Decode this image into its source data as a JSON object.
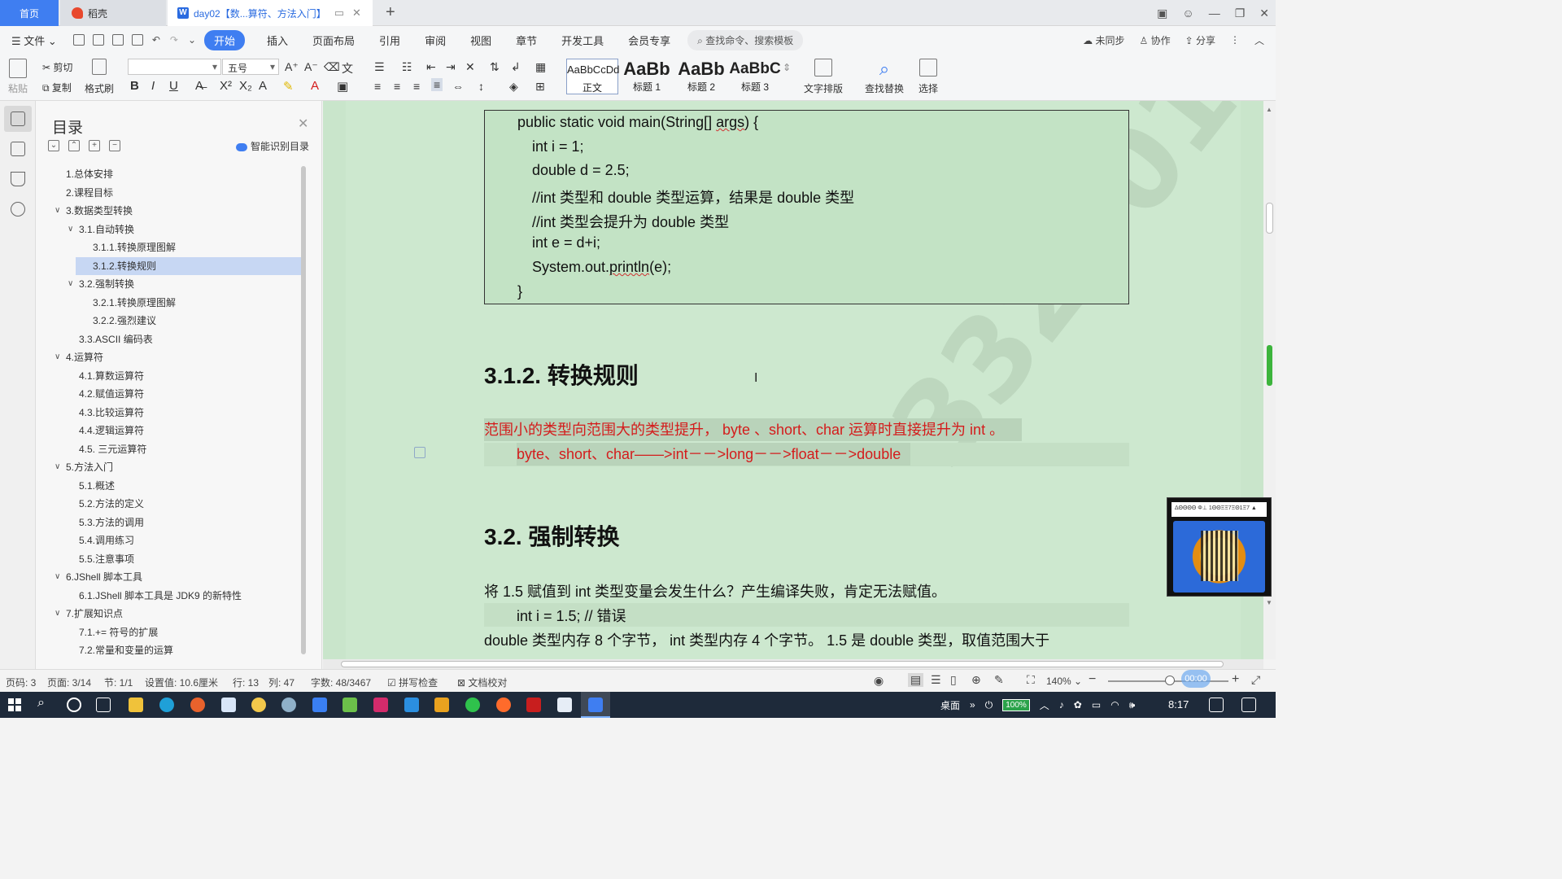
{
  "tabs": {
    "home": "首页",
    "daoke": "稻壳",
    "doc": "day02【数...算符、方法入门】"
  },
  "menu": {
    "file": "文件",
    "items": [
      "开始",
      "插入",
      "页面布局",
      "引用",
      "审阅",
      "视图",
      "章节",
      "开发工具",
      "会员专享"
    ],
    "search": "查找命令、搜索模板",
    "sync": "未同步",
    "collab": "协作",
    "share": "分享"
  },
  "ribbon": {
    "paste": "粘贴",
    "cut": "剪切",
    "copy": "复制",
    "format_painter": "格式刷",
    "font_name": "",
    "font_size": "五号",
    "styles": [
      {
        "sample": "AaBbCcDd",
        "name": "正文"
      },
      {
        "sample": "AaBb",
        "name": "标题 1"
      },
      {
        "sample": "AaBb",
        "name": "标题 2"
      },
      {
        "sample": "AaBbC",
        "name": "标题 3"
      }
    ],
    "text_layout": "文字排版",
    "find_replace": "查找替换",
    "select": "选择"
  },
  "toc": {
    "title": "目录",
    "smart": "智能识别目录",
    "items": [
      {
        "label": "1.总体安排",
        "level": 1,
        "arrow": false,
        "active": false
      },
      {
        "label": "2.课程目标",
        "level": 1,
        "arrow": false,
        "active": false
      },
      {
        "label": "3.数据类型转换",
        "level": 1,
        "arrow": true,
        "active": false
      },
      {
        "label": "3.1.自动转换",
        "level": 2,
        "arrow": true,
        "active": false
      },
      {
        "label": "3.1.1.转换原理图解",
        "level": 3,
        "arrow": false,
        "active": false
      },
      {
        "label": "3.1.2.转换规则",
        "level": 3,
        "arrow": false,
        "active": true
      },
      {
        "label": "3.2.强制转换",
        "level": 2,
        "arrow": true,
        "active": false
      },
      {
        "label": "3.2.1.转换原理图解",
        "level": 3,
        "arrow": false,
        "active": false
      },
      {
        "label": "3.2.2.强烈建议",
        "level": 3,
        "arrow": false,
        "active": false
      },
      {
        "label": "3.3.ASCII  编码表",
        "level": 2,
        "arrow": false,
        "active": false
      },
      {
        "label": "4.运算符",
        "level": 1,
        "arrow": true,
        "active": false
      },
      {
        "label": "4.1.算数运算符",
        "level": 2,
        "arrow": false,
        "active": false
      },
      {
        "label": "4.2.赋值运算符",
        "level": 2,
        "arrow": false,
        "active": false
      },
      {
        "label": "4.3.比较运算符",
        "level": 2,
        "arrow": false,
        "active": false
      },
      {
        "label": "4.4.逻辑运算符",
        "level": 2,
        "arrow": false,
        "active": false
      },
      {
        "label": "4.5.  三元运算符",
        "level": 2,
        "arrow": false,
        "active": false
      },
      {
        "label": "5.方法入门",
        "level": 1,
        "arrow": true,
        "active": false
      },
      {
        "label": "5.1.概述",
        "level": 2,
        "arrow": false,
        "active": false
      },
      {
        "label": "5.2.方法的定义",
        "level": 2,
        "arrow": false,
        "active": false
      },
      {
        "label": "5.3.方法的调用",
        "level": 2,
        "arrow": false,
        "active": false
      },
      {
        "label": "5.4.调用练习",
        "level": 2,
        "arrow": false,
        "active": false
      },
      {
        "label": "5.5.注意事项",
        "level": 2,
        "arrow": false,
        "active": false
      },
      {
        "label": "6.JShell 脚本工具",
        "level": 1,
        "arrow": true,
        "active": false
      },
      {
        "label": "6.1.JShell 脚本工具是 JDK9 的新特性",
        "level": 2,
        "arrow": false,
        "active": false
      },
      {
        "label": "7.扩展知识点",
        "level": 1,
        "arrow": true,
        "active": false
      },
      {
        "label": "7.1.+=  符号的扩展",
        "level": 2,
        "arrow": false,
        "active": false
      },
      {
        "label": "7.2.常量和变量的运算",
        "level": 2,
        "arrow": false,
        "active": false
      }
    ]
  },
  "document": {
    "code_lines": [
      "public static void main(String[] args) {",
      "int i = 1;",
      "double d = 2.5;",
      "//int 类型和 double 类型运算，结果是 double 类型",
      "//int 类型会提升为 double 类型",
      "int e = d+i;",
      "System.out.println(e);",
      "}"
    ],
    "heading_312": "3.1.2. 转换规则",
    "rule_text": "范围小的类型向范围大的类型提升，  byte  、short、char  运算时直接提升为  int  。",
    "rule_chain": "byte、short、char——>int－－>long－－>float－－>double",
    "heading_32": "3.2. 强制转换",
    "para1": "将  1.5  赋值到  int  类型变量会发生什么？产生编译失败，肯定无法赋值。",
    "code_err": "int i = 1.5; // 错误",
    "para2": "double  类型内存 8 个字节，  int  类型内存 4 个字节。  1.5  是  double  类型，取值范围大于",
    "watermark": "3325017"
  },
  "qr": {
    "top_text": "ΔΘΘΘΘ Φ⊥ 1ΘΘΞΞ7ΞΘ1Ξ7 ▲"
  },
  "status": {
    "page_code": "页码: 3",
    "page": "页面: 3/14",
    "section": "节: 1/1",
    "setting": "设置值: 10.6厘米",
    "row": "行: 13",
    "col": "列: 47",
    "words": "字数: 48/3467",
    "spell": "拼写检查",
    "proof": "文档校对",
    "zoom": "140%",
    "rec": "00:00"
  },
  "taskbar": {
    "desktop": "桌面",
    "battery": "100%",
    "time": "8:17"
  }
}
